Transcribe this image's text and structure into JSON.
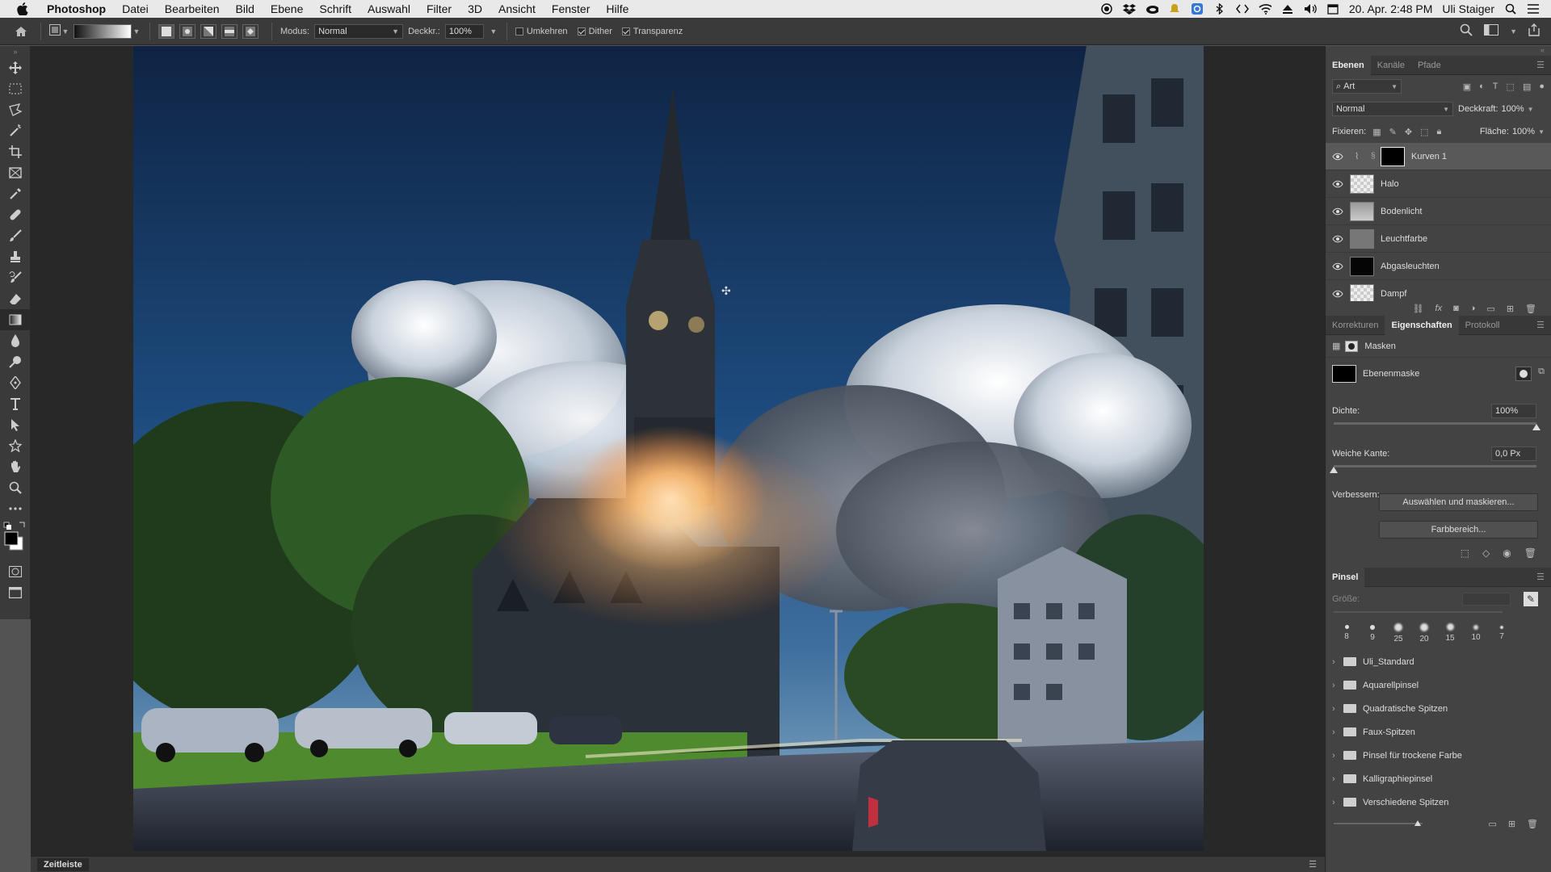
{
  "menubar": {
    "app": "Photoshop",
    "items": [
      "Datei",
      "Bearbeiten",
      "Bild",
      "Ebene",
      "Schrift",
      "Auswahl",
      "Filter",
      "3D",
      "Ansicht",
      "Fenster",
      "Hilfe"
    ],
    "datetime": "20. Apr. 2:48 PM",
    "user": "Uli Staiger"
  },
  "options": {
    "modus_label": "Modus:",
    "modus_value": "Normal",
    "deckkr_label": "Deckkr.:",
    "deckkr_value": "100%",
    "umkehren": "Umkehren",
    "dither": "Dither",
    "transparenz": "Transparenz"
  },
  "layers_panel": {
    "tabs": [
      "Ebenen",
      "Kanäle",
      "Pfade"
    ],
    "filter": "Art",
    "blend": "Normal",
    "deckkraft_label": "Deckkraft:",
    "deckkraft_value": "100%",
    "fixieren_label": "Fixieren:",
    "flaeche_label": "Fläche:",
    "flaeche_value": "100%",
    "layers": [
      {
        "name": "Kurven 1"
      },
      {
        "name": "Halo"
      },
      {
        "name": "Bodenlicht"
      },
      {
        "name": "Leuchtfarbe"
      },
      {
        "name": "Abgasleuchten"
      },
      {
        "name": "Dampf"
      }
    ]
  },
  "properties_panel": {
    "tabs": [
      "Korrekturen",
      "Eigenschaften",
      "Protokoll"
    ],
    "section": "Masken",
    "mask_label": "Ebenenmaske",
    "dichte_label": "Dichte:",
    "dichte_value": "100%",
    "dichte_level": 1.0,
    "kante_label": "Weiche Kante:",
    "kante_value": "0,0 Px",
    "kante_level": 0.0,
    "verbessern_label": "Verbessern:",
    "btn_select": "Auswählen und maskieren...",
    "btn_color": "Farbbereich..."
  },
  "brush_panel": {
    "title": "Pinsel",
    "size_label": "Größe:",
    "sizes": [
      "8",
      "9",
      "25",
      "20",
      "15",
      "10",
      "7"
    ],
    "folders": [
      "Uli_Standard",
      "Aquarellpinsel",
      "Quadratische Spitzen",
      "Faux-Spitzen",
      "Pinsel für trockene Farbe",
      "Kalligraphiepinsel",
      "Verschiedene Spitzen"
    ]
  },
  "timeline": {
    "label": "Zeitleiste"
  }
}
